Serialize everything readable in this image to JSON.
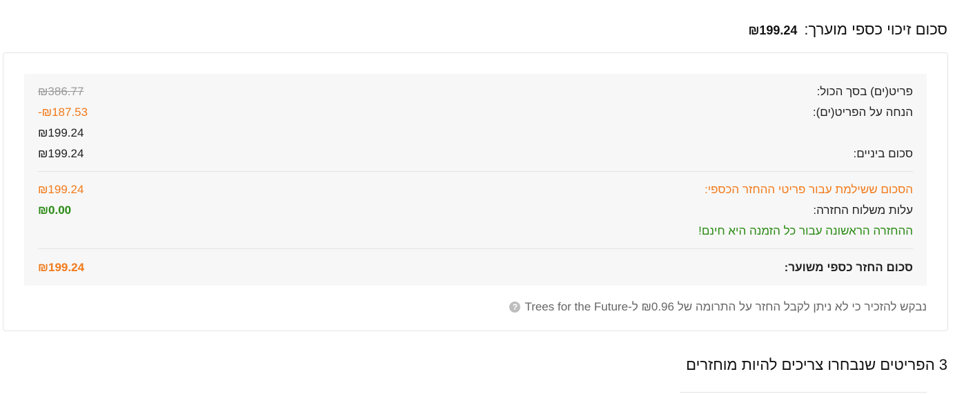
{
  "estimate": {
    "title": "סכום זיכוי כספי מוערך:",
    "amount": "₪199.24"
  },
  "summary": {
    "items_total_label": "פריט(ים) בסך הכול:",
    "items_total_value": "₪386.77",
    "discount_label": "הנחה על הפריט(ים):",
    "discount_value": "-₪187.53",
    "after_discount_value": "₪199.24",
    "subtotal_label": "סכום ביניים:",
    "subtotal_value": "₪199.24",
    "paid_label": "הסכום ששילמת עבור פריטי ההחזר הכספי:",
    "paid_value": "₪199.24",
    "shipping_label": "עלות משלוח החזרה:",
    "shipping_value": "₪0.00",
    "free_return_note": "ההחזרה הראשונה עבור כל הזמנה היא חינם!",
    "estimated_refund_label": "סכום החזר כספי משוער:",
    "estimated_refund_value": "₪199.24"
  },
  "donation_note": "נבקש להזכיר כי לא ניתן לקבל החזר על התרומה של ₪0.96 ל-Trees for the Future",
  "help_icon": "?",
  "items_heading": "3 הפריטים שנבחרו צריכים להיות מוחזרים",
  "colors": {
    "accent_orange": "#f27a1a",
    "success_green": "#2a8a14",
    "muted_gray": "#9a9a9a"
  }
}
